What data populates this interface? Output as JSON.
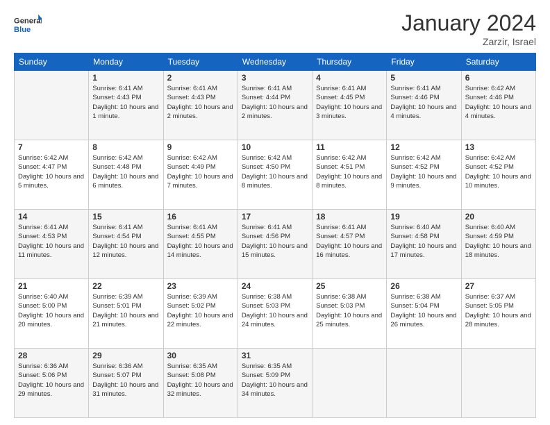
{
  "header": {
    "logo_general": "General",
    "logo_blue": "Blue",
    "month_year": "January 2024",
    "location": "Zarzir, Israel"
  },
  "days": [
    "Sunday",
    "Monday",
    "Tuesday",
    "Wednesday",
    "Thursday",
    "Friday",
    "Saturday"
  ],
  "weeks": [
    [
      {
        "date": "",
        "sunrise": "",
        "sunset": "",
        "daylight": ""
      },
      {
        "date": "1",
        "sunrise": "Sunrise: 6:41 AM",
        "sunset": "Sunset: 4:43 PM",
        "daylight": "Daylight: 10 hours and 1 minute."
      },
      {
        "date": "2",
        "sunrise": "Sunrise: 6:41 AM",
        "sunset": "Sunset: 4:43 PM",
        "daylight": "Daylight: 10 hours and 2 minutes."
      },
      {
        "date": "3",
        "sunrise": "Sunrise: 6:41 AM",
        "sunset": "Sunset: 4:44 PM",
        "daylight": "Daylight: 10 hours and 2 minutes."
      },
      {
        "date": "4",
        "sunrise": "Sunrise: 6:41 AM",
        "sunset": "Sunset: 4:45 PM",
        "daylight": "Daylight: 10 hours and 3 minutes."
      },
      {
        "date": "5",
        "sunrise": "Sunrise: 6:41 AM",
        "sunset": "Sunset: 4:46 PM",
        "daylight": "Daylight: 10 hours and 4 minutes."
      },
      {
        "date": "6",
        "sunrise": "Sunrise: 6:42 AM",
        "sunset": "Sunset: 4:46 PM",
        "daylight": "Daylight: 10 hours and 4 minutes."
      }
    ],
    [
      {
        "date": "7",
        "sunrise": "Sunrise: 6:42 AM",
        "sunset": "Sunset: 4:47 PM",
        "daylight": "Daylight: 10 hours and 5 minutes."
      },
      {
        "date": "8",
        "sunrise": "Sunrise: 6:42 AM",
        "sunset": "Sunset: 4:48 PM",
        "daylight": "Daylight: 10 hours and 6 minutes."
      },
      {
        "date": "9",
        "sunrise": "Sunrise: 6:42 AM",
        "sunset": "Sunset: 4:49 PM",
        "daylight": "Daylight: 10 hours and 7 minutes."
      },
      {
        "date": "10",
        "sunrise": "Sunrise: 6:42 AM",
        "sunset": "Sunset: 4:50 PM",
        "daylight": "Daylight: 10 hours and 8 minutes."
      },
      {
        "date": "11",
        "sunrise": "Sunrise: 6:42 AM",
        "sunset": "Sunset: 4:51 PM",
        "daylight": "Daylight: 10 hours and 8 minutes."
      },
      {
        "date": "12",
        "sunrise": "Sunrise: 6:42 AM",
        "sunset": "Sunset: 4:52 PM",
        "daylight": "Daylight: 10 hours and 9 minutes."
      },
      {
        "date": "13",
        "sunrise": "Sunrise: 6:42 AM",
        "sunset": "Sunset: 4:52 PM",
        "daylight": "Daylight: 10 hours and 10 minutes."
      }
    ],
    [
      {
        "date": "14",
        "sunrise": "Sunrise: 6:41 AM",
        "sunset": "Sunset: 4:53 PM",
        "daylight": "Daylight: 10 hours and 11 minutes."
      },
      {
        "date": "15",
        "sunrise": "Sunrise: 6:41 AM",
        "sunset": "Sunset: 4:54 PM",
        "daylight": "Daylight: 10 hours and 12 minutes."
      },
      {
        "date": "16",
        "sunrise": "Sunrise: 6:41 AM",
        "sunset": "Sunset: 4:55 PM",
        "daylight": "Daylight: 10 hours and 14 minutes."
      },
      {
        "date": "17",
        "sunrise": "Sunrise: 6:41 AM",
        "sunset": "Sunset: 4:56 PM",
        "daylight": "Daylight: 10 hours and 15 minutes."
      },
      {
        "date": "18",
        "sunrise": "Sunrise: 6:41 AM",
        "sunset": "Sunset: 4:57 PM",
        "daylight": "Daylight: 10 hours and 16 minutes."
      },
      {
        "date": "19",
        "sunrise": "Sunrise: 6:40 AM",
        "sunset": "Sunset: 4:58 PM",
        "daylight": "Daylight: 10 hours and 17 minutes."
      },
      {
        "date": "20",
        "sunrise": "Sunrise: 6:40 AM",
        "sunset": "Sunset: 4:59 PM",
        "daylight": "Daylight: 10 hours and 18 minutes."
      }
    ],
    [
      {
        "date": "21",
        "sunrise": "Sunrise: 6:40 AM",
        "sunset": "Sunset: 5:00 PM",
        "daylight": "Daylight: 10 hours and 20 minutes."
      },
      {
        "date": "22",
        "sunrise": "Sunrise: 6:39 AM",
        "sunset": "Sunset: 5:01 PM",
        "daylight": "Daylight: 10 hours and 21 minutes."
      },
      {
        "date": "23",
        "sunrise": "Sunrise: 6:39 AM",
        "sunset": "Sunset: 5:02 PM",
        "daylight": "Daylight: 10 hours and 22 minutes."
      },
      {
        "date": "24",
        "sunrise": "Sunrise: 6:38 AM",
        "sunset": "Sunset: 5:03 PM",
        "daylight": "Daylight: 10 hours and 24 minutes."
      },
      {
        "date": "25",
        "sunrise": "Sunrise: 6:38 AM",
        "sunset": "Sunset: 5:03 PM",
        "daylight": "Daylight: 10 hours and 25 minutes."
      },
      {
        "date": "26",
        "sunrise": "Sunrise: 6:38 AM",
        "sunset": "Sunset: 5:04 PM",
        "daylight": "Daylight: 10 hours and 26 minutes."
      },
      {
        "date": "27",
        "sunrise": "Sunrise: 6:37 AM",
        "sunset": "Sunset: 5:05 PM",
        "daylight": "Daylight: 10 hours and 28 minutes."
      }
    ],
    [
      {
        "date": "28",
        "sunrise": "Sunrise: 6:36 AM",
        "sunset": "Sunset: 5:06 PM",
        "daylight": "Daylight: 10 hours and 29 minutes."
      },
      {
        "date": "29",
        "sunrise": "Sunrise: 6:36 AM",
        "sunset": "Sunset: 5:07 PM",
        "daylight": "Daylight: 10 hours and 31 minutes."
      },
      {
        "date": "30",
        "sunrise": "Sunrise: 6:35 AM",
        "sunset": "Sunset: 5:08 PM",
        "daylight": "Daylight: 10 hours and 32 minutes."
      },
      {
        "date": "31",
        "sunrise": "Sunrise: 6:35 AM",
        "sunset": "Sunset: 5:09 PM",
        "daylight": "Daylight: 10 hours and 34 minutes."
      },
      {
        "date": "",
        "sunrise": "",
        "sunset": "",
        "daylight": ""
      },
      {
        "date": "",
        "sunrise": "",
        "sunset": "",
        "daylight": ""
      },
      {
        "date": "",
        "sunrise": "",
        "sunset": "",
        "daylight": ""
      }
    ]
  ]
}
